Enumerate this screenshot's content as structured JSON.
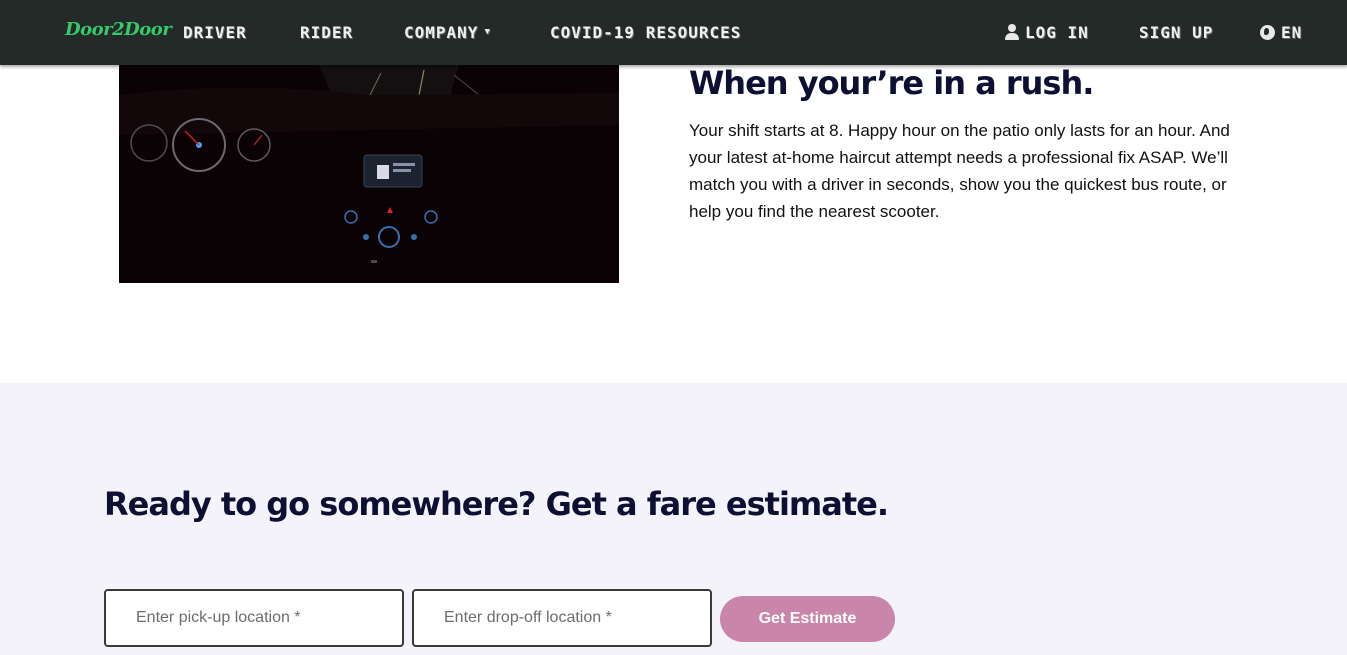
{
  "nav": {
    "brand": "Door2Door",
    "links": {
      "driver": "DRIVER",
      "rider": "RIDER",
      "company": "COMPANY",
      "covid": "COVID-19 RESOURCES",
      "login": "LOG IN",
      "signup": "SIGN UP",
      "language": "EN"
    },
    "icons": {
      "login": "user-icon",
      "language": "globe-icon",
      "company": "caret-down-icon"
    }
  },
  "hero": {
    "image_alt": "car dashboard at night",
    "title": "When your’re in a rush.",
    "body": "Your shift starts at 8. Happy hour on the patio only lasts for an hour. And your latest at-home haircut attempt needs a professional fix ASAP. We’ll match you with a driver in seconds, show you the quickest bus route, or help you find the nearest scooter."
  },
  "fare": {
    "title": "Ready to go somewhere? Get a fare estimate.",
    "pickup_placeholder": "Enter pick-up location *",
    "dropoff_placeholder": "Enter drop-off location *",
    "button_label": "Get Estimate"
  },
  "colors": {
    "navbar": "#232a28",
    "brand": "#37c96b",
    "heading": "#0e1033",
    "section_bg": "#f4f3f9",
    "button": "#c986aa"
  }
}
